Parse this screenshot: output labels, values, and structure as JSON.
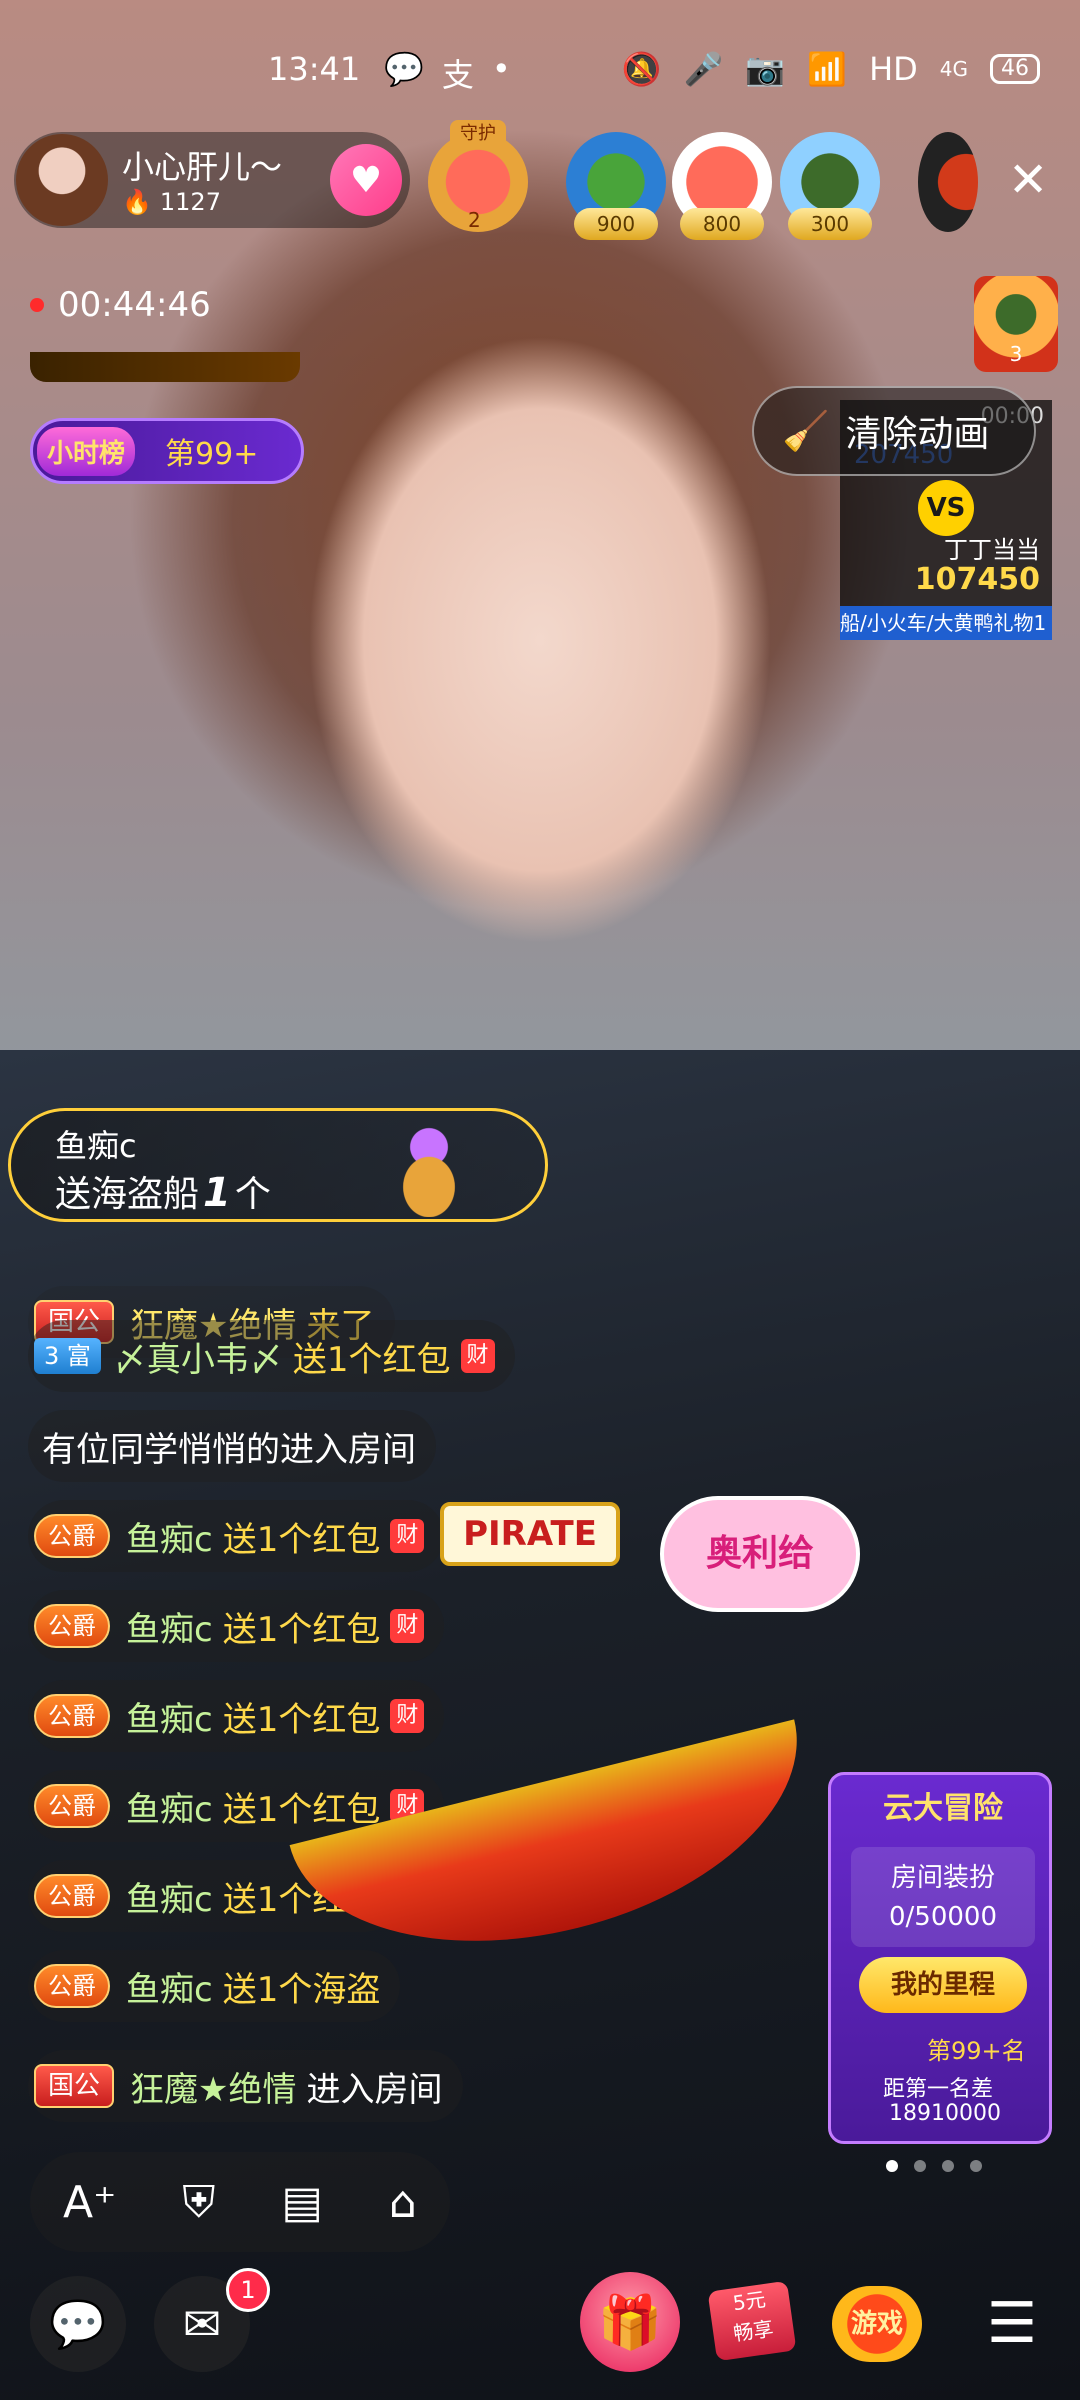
{
  "status_bar": {
    "time": "13:41",
    "left_icons": [
      "wechat-icon",
      "alipay-icon",
      "dot-icon"
    ],
    "hd": "HD",
    "network": "4G",
    "battery": "46"
  },
  "host": {
    "name": "小心肝儿～",
    "heat": "1127"
  },
  "top_viewers": {
    "guard_label": "守护",
    "guard_count": "2",
    "v1_score": "900",
    "v2_score": "800",
    "v3_score": "300"
  },
  "live": {
    "elapsed": "00:44:46"
  },
  "ranks": {
    "hour_tag": "小时榜",
    "hour_pos": "第99+"
  },
  "clear_animation": {
    "label": "清除动画"
  },
  "pk": {
    "time": "00:00",
    "top_score": "207450",
    "vs": "VS",
    "opponent": "丁丁当当",
    "score": "107450",
    "gifts": "船/小火车/大黄鸭礼物1"
  },
  "crown": {
    "count": "3"
  },
  "gift_banner": {
    "sender": "鱼痴c",
    "prefix": "送海盗船",
    "count": "1",
    "unit": "个"
  },
  "chat": [
    {
      "badge": "国公",
      "name": "狂魔★绝情",
      "text": "来了"
    },
    {
      "badge": "3 富",
      "name": "〆真小韦〆",
      "text": "送1个红包"
    },
    {
      "text": "有位同学悄悄的进入房间"
    },
    {
      "badge": "公爵",
      "name": "鱼痴c",
      "text": "送1个红包"
    },
    {
      "badge": "公爵",
      "name": "鱼痴c",
      "text": "送1个红包"
    },
    {
      "badge": "公爵",
      "name": "鱼痴c",
      "text": "送1个红包"
    },
    {
      "badge": "公爵",
      "name": "鱼痴c",
      "text": "送1个红包"
    },
    {
      "badge": "公爵",
      "name": "鱼痴c",
      "text": "送1个红包"
    },
    {
      "badge": "公爵",
      "name": "鱼痴c",
      "text": "送1个海盗"
    },
    {
      "badge": "国公",
      "name": "狂魔★绝情",
      "text": "进入房间"
    }
  ],
  "ship_effect": {
    "sign": "PIRATE",
    "bubble": "奥利给"
  },
  "adventure": {
    "title": "云大冒险",
    "dress_label": "房间装扮",
    "dress_value": "0/50000",
    "milestone": "我的里程",
    "rank": "第99+名",
    "gap_label": "距第一名差",
    "gap_value": "18910000"
  },
  "toolbar": {
    "icons": [
      "font-size-icon",
      "guard-icon",
      "task-icon",
      "tag-icon"
    ]
  },
  "bottom": {
    "msg_count": "1",
    "share_line1": "5元",
    "share_line2": "畅享",
    "game_label": "游戏"
  }
}
